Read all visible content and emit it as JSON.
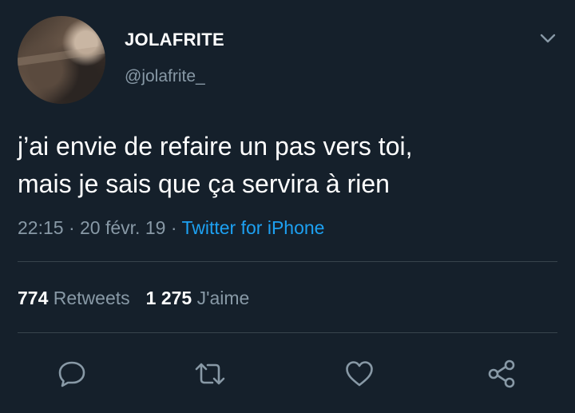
{
  "user": {
    "display_name": "JOLAFRITE",
    "handle": "@jolafrite_"
  },
  "tweet": {
    "lines": [
      "j’ai envie de refaire un pas vers toi,",
      "mais je sais que ça servira à rien"
    ],
    "time": "22:15",
    "separator": "·",
    "date": "20 févr. 19",
    "source": "Twitter for iPhone"
  },
  "stats": {
    "retweets_count": "774",
    "retweets_label": "Retweets",
    "likes_count": "1 275",
    "likes_label": "J'aime"
  },
  "icons": {
    "menu": "chevron-down-icon",
    "reply": "reply-icon",
    "retweet": "retweet-icon",
    "like": "heart-icon",
    "share": "share-icon"
  },
  "colors": {
    "background": "#15202b",
    "secondary_text": "#8899a6",
    "accent": "#1da1f2",
    "divider": "#38444d"
  }
}
